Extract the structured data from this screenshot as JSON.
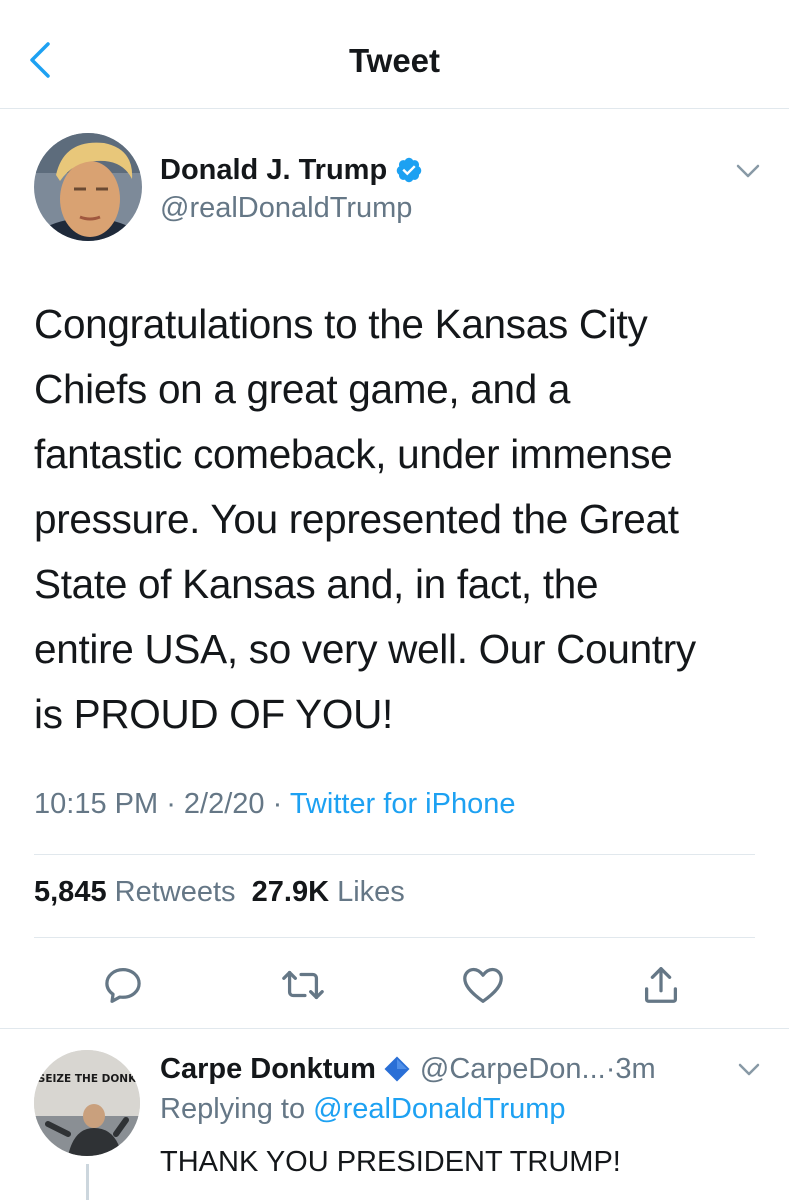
{
  "header": {
    "title": "Tweet"
  },
  "author": {
    "name": "Donald J. Trump",
    "handle": "@realDonaldTrump",
    "verified": true
  },
  "tweet": {
    "lines": [
      "Congratulations to the Kansas City",
      "Chiefs on a great game, and a",
      "fantastic comeback, under immense",
      "pressure. You represented the Great",
      "State of Kansas and, in fact, the",
      "entire USA, so very well. Our Country",
      "is PROUD OF YOU!"
    ],
    "time": "10:15 PM",
    "date": "2/2/20",
    "separator": " · ",
    "source": "Twitter for iPhone"
  },
  "stats": {
    "retweets_count": "5,845",
    "retweets_label": "Retweets",
    "likes_count": "27.9K",
    "likes_label": "Likes"
  },
  "actions": [
    "reply-icon",
    "retweet-icon",
    "like-icon",
    "share-icon"
  ],
  "reply": {
    "name": "Carpe Donktum",
    "handle": "@CarpeDon...",
    "time_separator": " · ",
    "time": "3m",
    "replying_prefix": "Replying to ",
    "replying_to": "@realDonaldTrump",
    "text": "THANK YOU PRESIDENT TRUMP!",
    "avatar_caption": "SEIZE THE DONK"
  },
  "colors": {
    "accent": "#1da1f2",
    "text": "#14171a",
    "secondary": "#657786",
    "divider": "#e1e8ed",
    "diamond": "#2a6fd6"
  }
}
